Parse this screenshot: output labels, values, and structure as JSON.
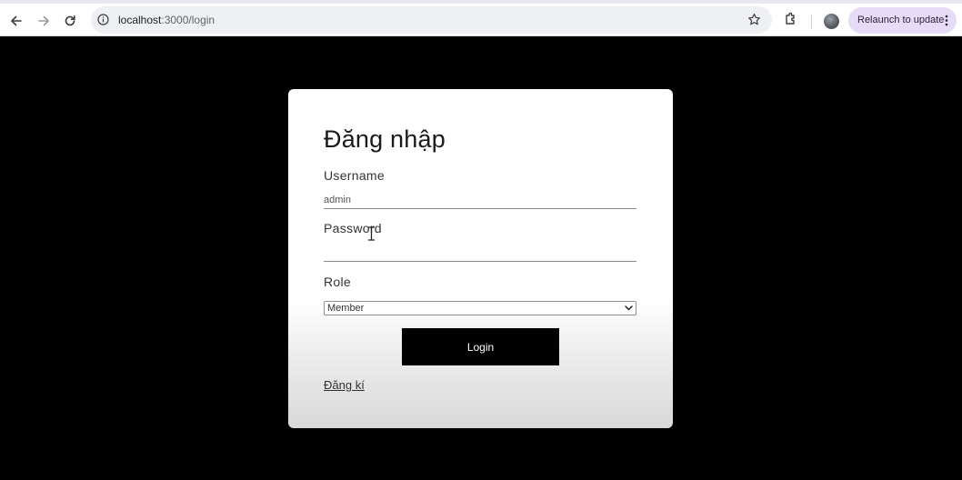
{
  "browser": {
    "url_host": "localhost",
    "url_path": ":3000/login",
    "relaunch_label": "Relaunch to update",
    "icons": [
      "back-arrow-icon",
      "forward-arrow-icon",
      "reload-icon",
      "site-info-icon",
      "bookmark-star-icon",
      "extensions-icon",
      "kebab-menu-icon"
    ]
  },
  "login_form": {
    "title": "Đăng nhập",
    "username_label": "Username",
    "username_value": "admin",
    "password_label": "Password",
    "password_value": "",
    "role_label": "Role",
    "role_selected": "Member",
    "submit_label": "Login",
    "register_link": "Đăng kí"
  },
  "colors": {
    "page_background": "#000000",
    "card_background": "#ffffff",
    "button_background": "#000000",
    "relaunch_chip": "#e7dcf7"
  }
}
